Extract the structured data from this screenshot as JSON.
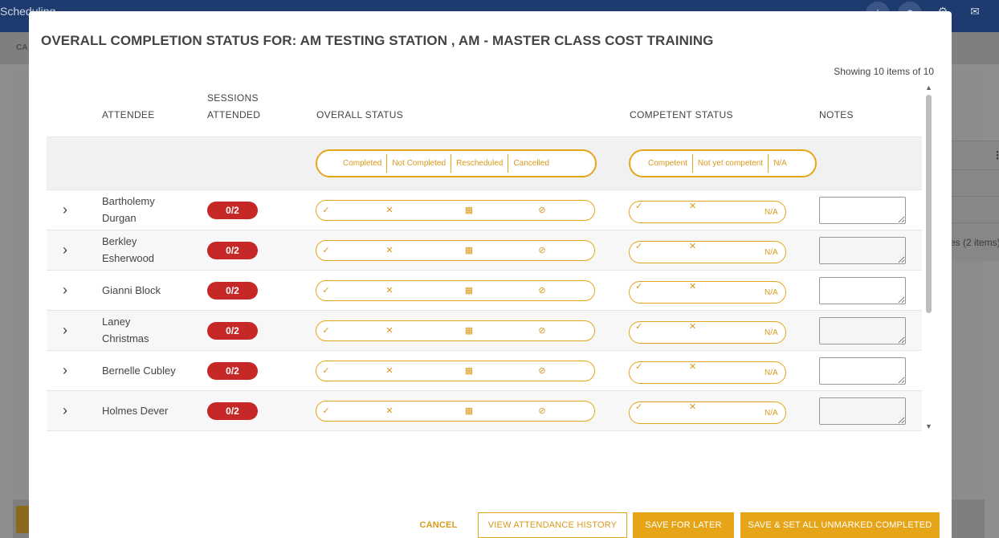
{
  "app": {
    "title": "Scheduling",
    "crumb": "CA",
    "icons": [
      "more-vertical-icon",
      "help-icon",
      "gear-icon",
      "mail-icon"
    ],
    "bg_text": "es (2 items)"
  },
  "modal": {
    "title": "OVERALL COMPLETION STATUS FOR: AM TESTING STATION , AM - MASTER CLASS COST TRAINING",
    "showing": "Showing 10 items of 10"
  },
  "columns": {
    "attendee": "ATTENDEE",
    "sessions_line1": "SESSIONS",
    "sessions_line2": "ATTENDED",
    "overall": "OVERALL STATUS",
    "competent": "COMPETENT STATUS",
    "notes": "NOTES"
  },
  "legend_overall": [
    "Completed",
    "Not Completed",
    "Rescheduled",
    "Cancelled"
  ],
  "legend_competent": [
    "Competent",
    "Not yet competent",
    "N/A"
  ],
  "status_icons": {
    "check": "✓",
    "cross": "✕",
    "calendar": "▦",
    "cancel": "⊘",
    "na": "N/A"
  },
  "rows": [
    {
      "name_line1": "Bartholemy",
      "name_line2": "Durgan",
      "sessions": "0/2"
    },
    {
      "name_line1": "Berkley",
      "name_line2": "Esherwood",
      "sessions": "0/2"
    },
    {
      "name_line1": "Gianni Block",
      "name_line2": "",
      "sessions": "0/2"
    },
    {
      "name_line1": "Laney",
      "name_line2": "Christmas",
      "sessions": "0/2"
    },
    {
      "name_line1": "Bernelle Cubley",
      "name_line2": "",
      "sessions": "0/2"
    },
    {
      "name_line1": "Holmes Dever",
      "name_line2": "",
      "sessions": "0/2"
    }
  ],
  "footer": {
    "cancel": "CANCEL",
    "history": "VIEW ATTENDANCE HISTORY",
    "save_later": "SAVE FOR LATER",
    "save_all": "SAVE & SET ALL UNMARKED COMPLETED"
  }
}
